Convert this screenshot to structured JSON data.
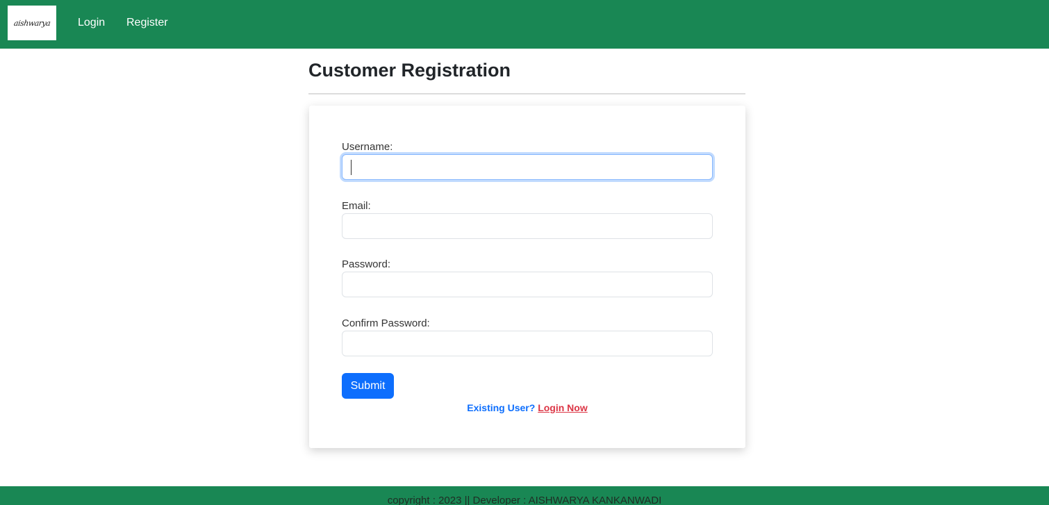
{
  "brand": {
    "logo_text": "aishwarya"
  },
  "nav": {
    "login_label": "Login",
    "register_label": "Register"
  },
  "page": {
    "title": "Customer Registration"
  },
  "form": {
    "username": {
      "label": "Username:",
      "value": ""
    },
    "email": {
      "label": "Email:",
      "value": ""
    },
    "password": {
      "label": "Password:",
      "value": ""
    },
    "confirm_password": {
      "label": "Confirm Password:",
      "value": ""
    },
    "submit_label": "Submit",
    "existing_user_text": "Existing User?",
    "login_now_label": "Login Now"
  },
  "footer": {
    "text": "copyright : 2023 || Developer : AISHWARYA KANKANWADI"
  },
  "colors": {
    "navbar": "#198754",
    "primary": "#0d6efd",
    "danger": "#dc3545"
  }
}
